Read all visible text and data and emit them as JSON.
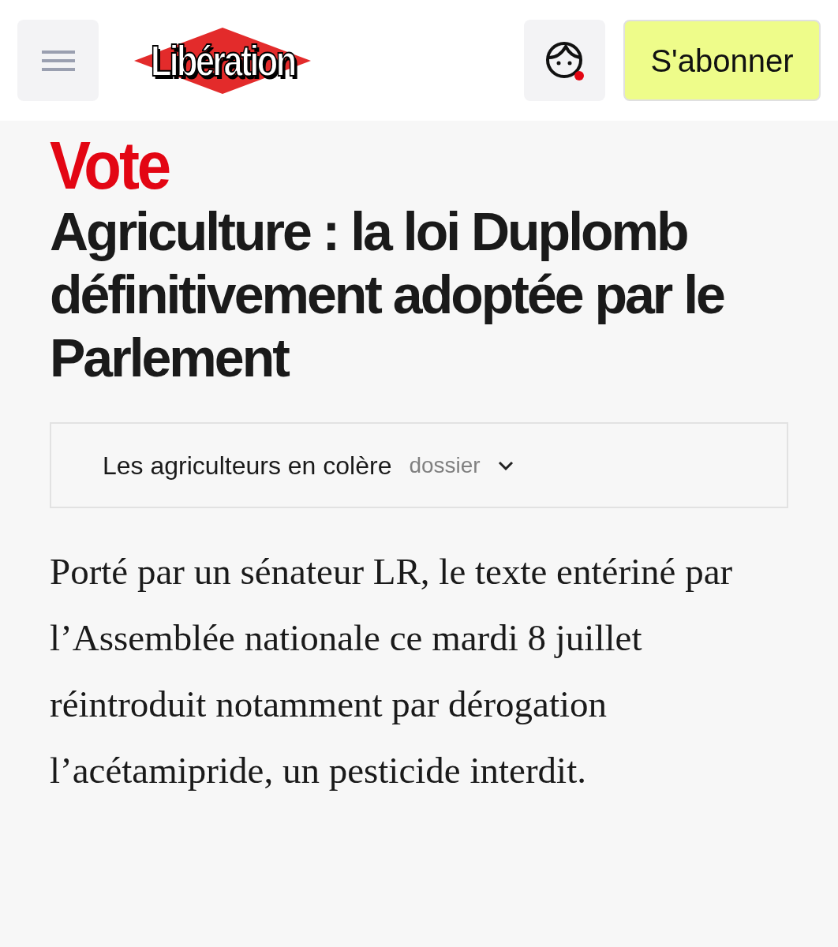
{
  "header": {
    "logo": "Libération",
    "subscribe_button": "S'abonner",
    "notification": true
  },
  "article": {
    "kicker": "Vote",
    "headline": "Agriculture : la loi Duplomb définitivement adoptée par le Parlement",
    "dossier": {
      "title": "Les agriculteurs en colère",
      "label": "dossier",
      "expanded": false
    },
    "lead": "Porté par un sénateur LR, le texte entériné par l’Assemblée nationale ce mardi 8 juillet réintroduit notamment par dérogation l’acétamipride, un pesticide interdit."
  }
}
